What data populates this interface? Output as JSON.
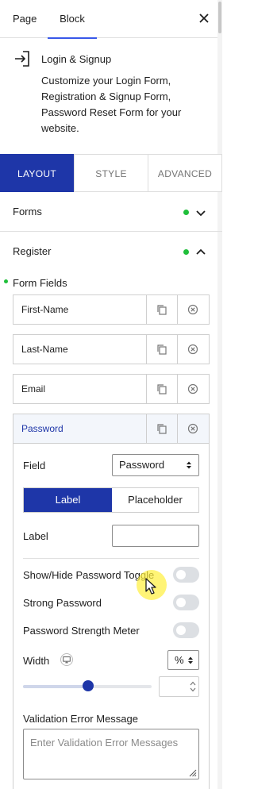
{
  "top_tabs": {
    "page": "Page",
    "block": "Block"
  },
  "block": {
    "title": "Login & Signup",
    "description": "Customize your Login Form, Registration & Signup Form, Password Reset Form for your website."
  },
  "panel_tabs": {
    "layout": "LAYOUT",
    "style": "STYLE",
    "advanced": "ADVANCED"
  },
  "sections": {
    "forms": "Forms",
    "register": "Register",
    "form_fields": "Form Fields"
  },
  "fields": [
    "First-Name",
    "Last-Name",
    "Email",
    "Password"
  ],
  "password_settings": {
    "field_label": "Field",
    "field_value": "Password",
    "segment": {
      "label": "Label",
      "placeholder": "Placeholder",
      "selected": "Label"
    },
    "label_label": "Label",
    "label_value": "",
    "show_hide_toggle": {
      "label": "Show/Hide Password Toggle",
      "enabled": false
    },
    "strong_password": {
      "label": "Strong Password",
      "enabled": false
    },
    "strength_meter": {
      "label": "Password Strength Meter",
      "enabled": false
    },
    "width_label": "Width",
    "width_unit": "%",
    "width_value": "",
    "validation_label": "Validation Error Message",
    "validation_placeholder": "Enter Validation Error Messages"
  },
  "colors": {
    "accent": "#1e36a8",
    "status_green": "#1fbf3a",
    "wp_blue": "#3858e9"
  },
  "icons": [
    "close-icon",
    "login-icon",
    "chevron-down-icon",
    "chevron-up-icon",
    "duplicate-icon",
    "remove-icon",
    "select-arrows-icon",
    "monitor-icon",
    "resize-grip-icon",
    "mouse-cursor-icon"
  ]
}
